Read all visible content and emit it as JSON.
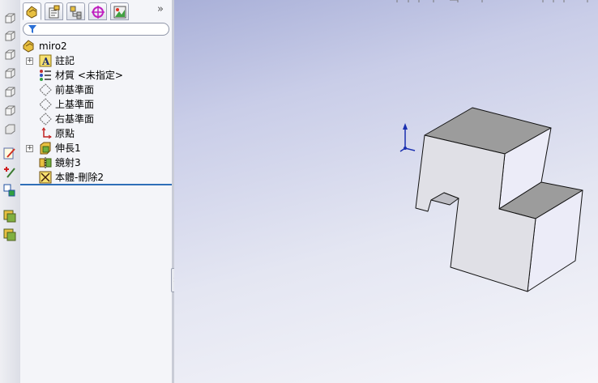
{
  "tabs": [
    {
      "name": "feature-manager",
      "icon": "feature-tree-icon",
      "active": true
    },
    {
      "name": "property-manager",
      "icon": "property-manager-icon"
    },
    {
      "name": "configuration-manager",
      "icon": "configuration-icon"
    },
    {
      "name": "dimxpert-manager",
      "icon": "dimxpert-icon"
    },
    {
      "name": "display-manager",
      "icon": "display-manager-icon"
    }
  ],
  "more_tabs_label": "»",
  "filter": {
    "placeholder": ""
  },
  "tree": {
    "root": "miro2",
    "items": [
      {
        "label": "註記",
        "icon": "annotation-icon",
        "expandable": true
      },
      {
        "label": "材質 <未指定>",
        "icon": "material-icon",
        "expandable": false
      },
      {
        "label": "前基準面",
        "icon": "plane-icon",
        "expandable": false
      },
      {
        "label": "上基準面",
        "icon": "plane-icon",
        "expandable": false
      },
      {
        "label": "右基準面",
        "icon": "plane-icon",
        "expandable": false
      },
      {
        "label": "原點",
        "icon": "origin-icon",
        "expandable": false
      },
      {
        "label": "伸長1",
        "icon": "extrude-icon",
        "expandable": true
      },
      {
        "label": "鏡射3",
        "icon": "mirror-icon",
        "expandable": false
      },
      {
        "label": "本體-刪除2",
        "icon": "delete-body-icon",
        "expandable": false
      }
    ]
  },
  "splitter_grip": "‹‹",
  "colors": {
    "selection_line": "#2f6fb8",
    "model_top": "#9c9c9c",
    "model_front": "#e0e0e6",
    "model_side": "#ececf8"
  }
}
